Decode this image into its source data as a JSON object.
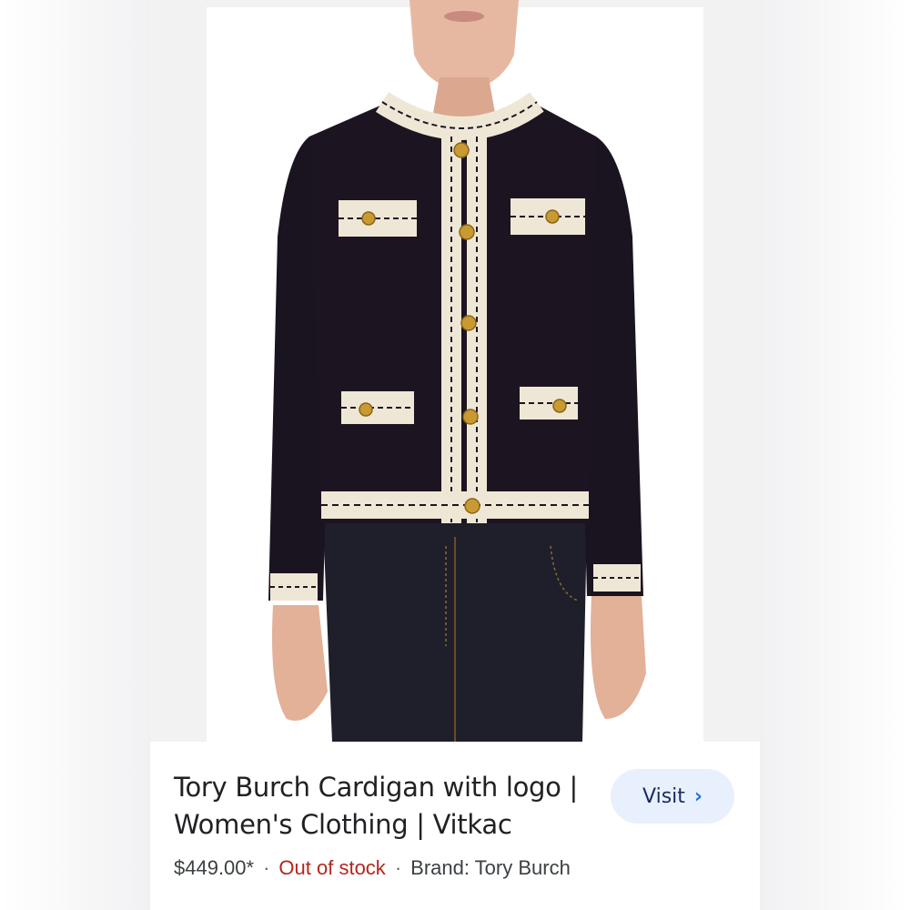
{
  "product": {
    "title_line1": "Tory Burch Cardigan with logo |",
    "title_line2": "Women's Clothing | Vitkac",
    "price": "$449.00*",
    "stock_status": "Out of stock",
    "brand": "Brand: Tory Burch",
    "separator": "·",
    "image_icon": "product-photo-icon"
  },
  "actions": {
    "visit_label": "Visit",
    "visit_icon": "chevron-right-icon"
  },
  "colors": {
    "accent": "#1a73e8",
    "button_bg": "#e8f0fe",
    "out_of_stock": "#b3261e"
  }
}
